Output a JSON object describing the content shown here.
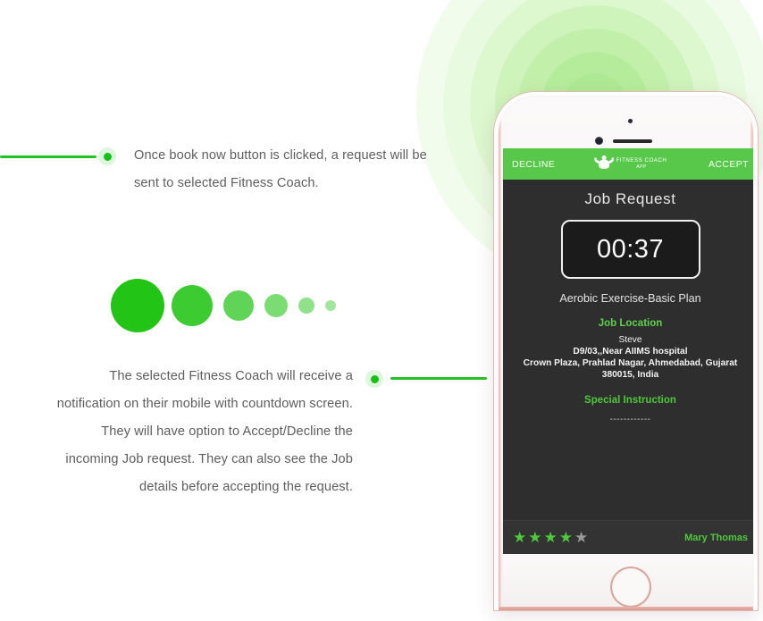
{
  "page": {
    "background": "#ffffff",
    "accent_green": "#22c322",
    "brand_green": "#58c84b",
    "bezel_rose": "#e7b8b3"
  },
  "callouts": [
    {
      "id": "callout-1",
      "text": "Once book now button is clicked, a request will be sent to selected Fitness Coach."
    },
    {
      "id": "callout-2",
      "text": "The selected Fitness Coach will receive a notification on their mobile with countdown screen. They will have option to Accept/Decline the incoming Job request. They can also see the Job details before accepting the request."
    }
  ],
  "decor": {
    "dots": [
      {
        "size": 60,
        "opacity": 1.0
      },
      {
        "size": 46,
        "opacity": 0.88
      },
      {
        "size": 34,
        "opacity": 0.72
      },
      {
        "size": 26,
        "opacity": 0.6
      },
      {
        "size": 18,
        "opacity": 0.5
      },
      {
        "size": 12,
        "opacity": 0.42
      }
    ],
    "glow_rings": [
      {
        "size": 400,
        "color": "#f2fced"
      },
      {
        "size": 340,
        "color": "#e8fadf"
      },
      {
        "size": 280,
        "color": "#ddf7cf"
      },
      {
        "size": 224,
        "color": "#cef3bb"
      },
      {
        "size": 172,
        "color": "#c2f0ab"
      },
      {
        "size": 120,
        "color": "#b5ec9c"
      },
      {
        "size": 72,
        "color": "#aeea93"
      }
    ]
  },
  "phone": {
    "app": {
      "decline_label": "DECLINE",
      "accept_label": "ACCEPT",
      "logo_line1": "FITNESS COACH",
      "logo_line2": "APP",
      "screen_title": "Job  Request",
      "timer": "00:37",
      "plan_name": "Aerobic Exercise-Basic Plan",
      "job_location_heading": "Job Location",
      "customer_name": "Steve",
      "address_line1": "D9/03,,Near AIIMS hospital",
      "address_line2": "Crown Plaza, Prahlad Nagar, Ahmedabad, Gujarat",
      "address_line3": "380015, India",
      "special_instruction_heading": "Special Instruction",
      "special_instruction_value": "------------",
      "rating": {
        "filled": 4,
        "total": 5,
        "star_glyph": "★"
      },
      "reviewer_name": "Mary Thomas"
    }
  }
}
